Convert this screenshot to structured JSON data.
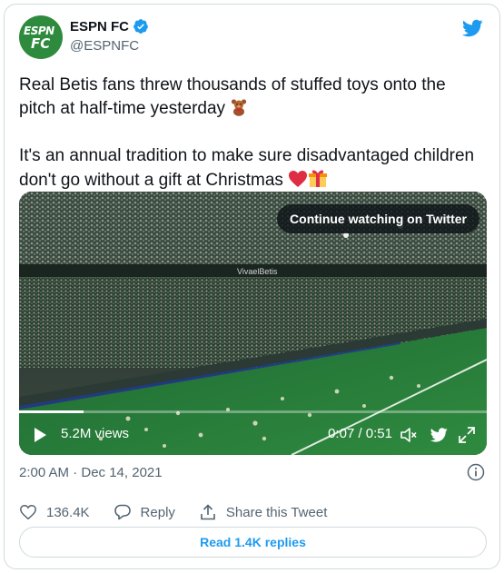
{
  "author": {
    "name": "ESPN FC",
    "handle": "@ESPNFC",
    "avatar_text_line1": "ESPN",
    "avatar_text_line2": "FC",
    "avatar_color": "#2e8b3d",
    "verified": true
  },
  "tweet": {
    "paragraph1": "Real Betis fans threw thousands of stuffed toys onto the pitch at half-time yesterday",
    "paragraph2": "It's an annual tradition to make sure disadvantaged children don't go without a gift at Christmas",
    "emoji1": "teddy-bear",
    "emoji2": [
      "red-heart",
      "wrapped-gift"
    ]
  },
  "video": {
    "continue_label": "Continue watching on Twitter",
    "views": "5.2M views",
    "time": "0:07 / 0:51",
    "progress": 0.137
  },
  "meta": {
    "timestamp": "2:00 AM · Dec 14, 2021"
  },
  "actions": {
    "likes": "136.4K",
    "reply_label": "Reply",
    "share_label": "Share this Tweet"
  },
  "read_replies_label": "Read 1.4K replies",
  "colors": {
    "twitter_blue": "#1d9bf0",
    "text": "#0f1419",
    "muted": "#536471",
    "border": "#cfd9de"
  }
}
